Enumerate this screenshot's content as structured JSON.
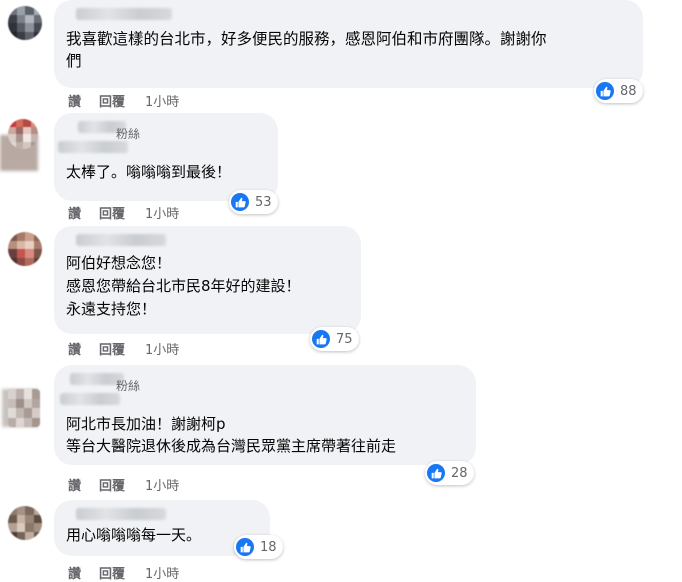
{
  "actions": {
    "like_label": "讚",
    "reply_label": "回覆"
  },
  "colors": {
    "bubble_bg": "#f0f2f5",
    "like_blue": "#1877f2",
    "meta_gray": "#65676b",
    "text": "#050505"
  },
  "comments": [
    {
      "text": "我喜歡這樣的台北市，好多便民的服務，感恩阿伯和市府團隊。謝謝你\n們",
      "likes": "88",
      "time": "1小時",
      "fans_label": ""
    },
    {
      "text": "太棒了。嗡嗡嗡到最後！",
      "likes": "53",
      "time": "1小時",
      "fans_label": "粉絲"
    },
    {
      "text": "阿伯好想念您！\n感恩您帶給台北市民8年好的建設！\n永遠支持您！",
      "likes": "75",
      "time": "1小時",
      "fans_label": ""
    },
    {
      "text": "阿北市長加油！謝謝柯p\n等台大醫院退休後成為台灣民眾黨主席帶著往前走",
      "likes": "28",
      "time": "1小時",
      "fans_label": "粉絲"
    },
    {
      "text": "用心嗡嗡嗡每一天。",
      "likes": "18",
      "time": "1小時",
      "fans_label": ""
    }
  ]
}
